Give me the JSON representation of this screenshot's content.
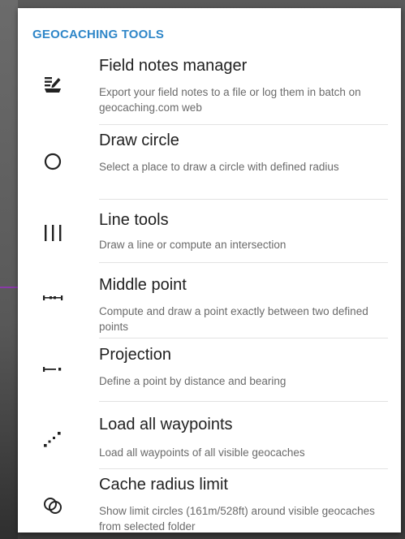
{
  "section": {
    "title": "GEOCACHING TOOLS"
  },
  "items": [
    {
      "icon": "field-notes-icon",
      "title": "Field notes manager",
      "description": "Export your field notes to a file or log them in batch on geocaching.com web"
    },
    {
      "icon": "circle-icon",
      "title": "Draw circle",
      "description": "Select a place to draw a circle with defined radius"
    },
    {
      "icon": "line-tools-icon",
      "title": "Line tools",
      "description": "Draw a line or compute an intersection"
    },
    {
      "icon": "middle-point-icon",
      "title": "Middle point",
      "description": "Compute and draw a point exactly between two defined points"
    },
    {
      "icon": "projection-icon",
      "title": "Projection",
      "description": "Define a point by distance and bearing"
    },
    {
      "icon": "waypoints-icon",
      "title": "Load all waypoints",
      "description": "Load all waypoints of all visible geocaches"
    },
    {
      "icon": "cache-radius-icon",
      "title": "Cache radius limit",
      "description": "Show limit circles (161m/528ft) around visible geocaches from selected folder"
    }
  ],
  "colors": {
    "accent": "#2e86c8",
    "title_text": "#212121",
    "desc_text": "#6a6a6a"
  }
}
